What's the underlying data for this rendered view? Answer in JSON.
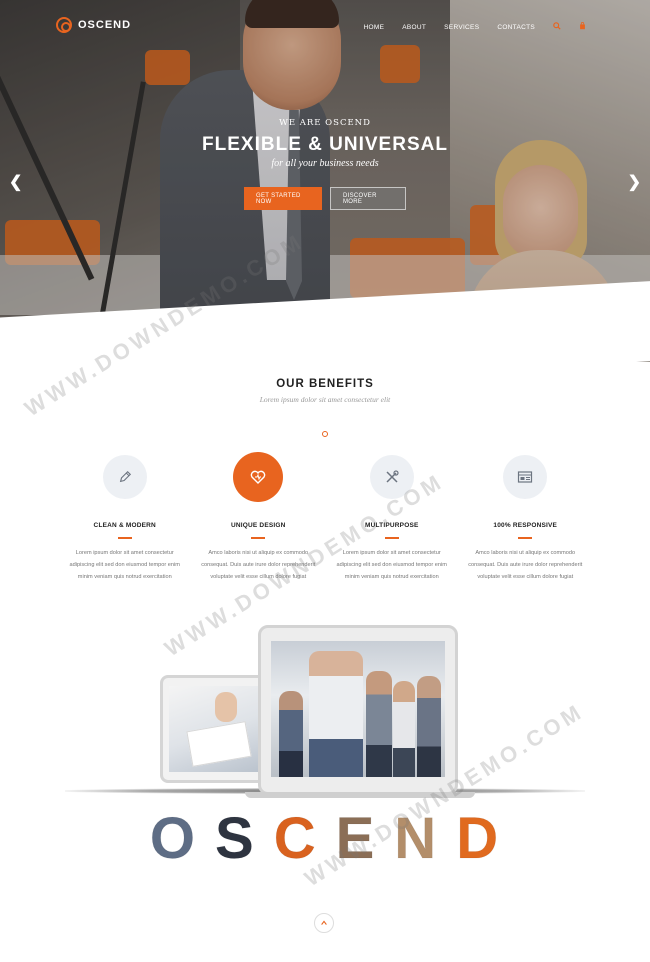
{
  "brand": {
    "name": "OSCEND",
    "accent": "#e8641f"
  },
  "nav": {
    "items": [
      "HOME",
      "ABOUT",
      "SERVICES",
      "CONTACTS"
    ],
    "icons": [
      "search-icon",
      "cart-icon"
    ]
  },
  "hero": {
    "kicker": "WE ARE OSCEND",
    "headline": "FLEXIBLE & UNIVERSAL",
    "subline": "for all your business needs",
    "primary_button": "GET STARTED NOW",
    "secondary_button": "DISCOVER MORE",
    "prev_arrow": "❮",
    "next_arrow": "❯"
  },
  "benefits": {
    "title": "OUR BENEFITS",
    "subtitle": "Lorem ipsum dolor sit amet consectetur elit",
    "items": [
      {
        "icon": "pencil-icon",
        "title": "CLEAN & MODERN",
        "text": "Lorem ipsum dolor sit amet consectetur adipiscing elit sed don eiusmod tempor enim minim veniam quis notrud exercitation"
      },
      {
        "icon": "heart-icon",
        "title": "UNIQUE DESIGN",
        "text": "Amco laboris nisi ut aliquip ex commodo consequat. Duis aute irure dolor reprehenderit voluptate velit esse cillum dolore fugiat"
      },
      {
        "icon": "tools-icon",
        "title": "MULTIPURPOSE",
        "text": "Lorem ipsum dolor sit amet consectetur adipiscing elit sed don eiusmod tempor enim minim veniam quis notrud exercitation"
      },
      {
        "icon": "browser-icon",
        "title": "100% RESPONSIVE",
        "text": "Amco laboris nisi ut aliquip ex commodo consequat. Duis aute irure dolor reprehenderit voluptate velit esse cillum dolore fugiat"
      }
    ]
  },
  "showcase": {
    "letters": [
      "O",
      "S",
      "C",
      "E",
      "N",
      "D"
    ]
  },
  "watermark": "WWW.DOWNDEMO.COM"
}
